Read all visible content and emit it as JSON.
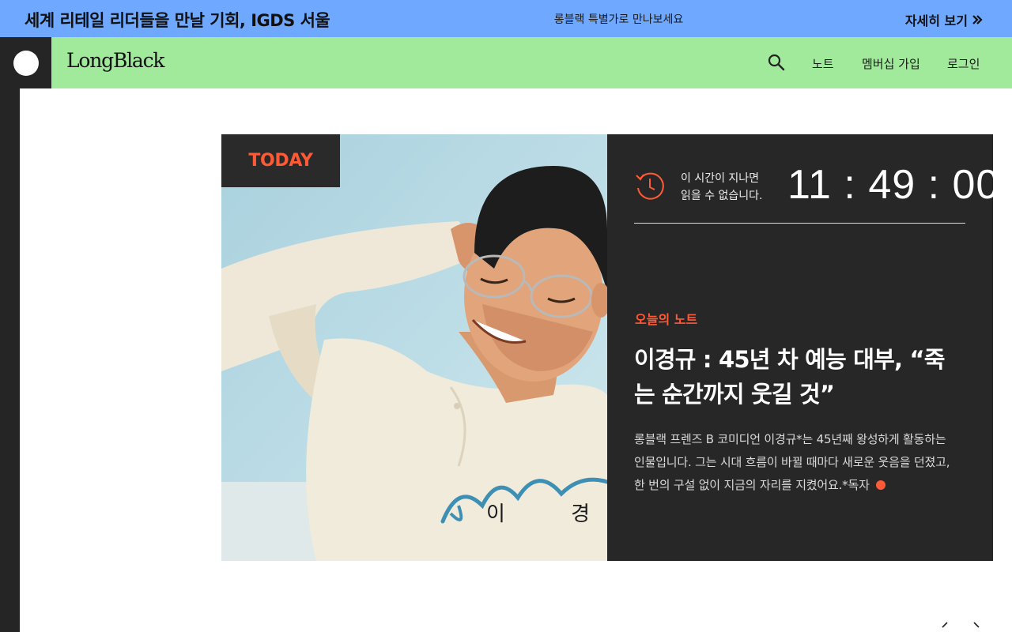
{
  "promo": {
    "title": "세계 리테일 리더들을 만날 기회, IGDS 서울",
    "subtitle": "롱블랙 특별가로 만나보세요",
    "link_label": "자세히 보기",
    "background": "#6fa8ff"
  },
  "header": {
    "brand": "LongBlack",
    "background": "#a1e99b",
    "nav": {
      "search_icon": "search-icon",
      "note": "노트",
      "membership": "멤버십 가입",
      "login": "로그인"
    }
  },
  "feature": {
    "badge": "TODAY",
    "timer": {
      "line1": "이 시간이 지나면",
      "line2": "읽을 수 없습니다.",
      "countdown": "11 : 49 : 00"
    },
    "kicker": "오늘의 노트",
    "headline": "이경규 : 45년 차 예능 대부, “죽는 순간까지 웃길 것”",
    "summary": "롱블랙 프렌즈 B 코미디언 이경규*는 45년째 왕성하게 활동하는 인물입니다. 그는 시대 흐름이 바뀔 때마다 새로운 웃음을 던졌고, 한 번의 구설 없이 지금의 자리를 지켰어요.*독자",
    "image_caption": "이 경 규",
    "accent_color": "#ff5a36",
    "panel_color": "#272727"
  },
  "carousel": {
    "prev_icon": "chevron-left-icon",
    "next_icon": "chevron-right-icon"
  }
}
